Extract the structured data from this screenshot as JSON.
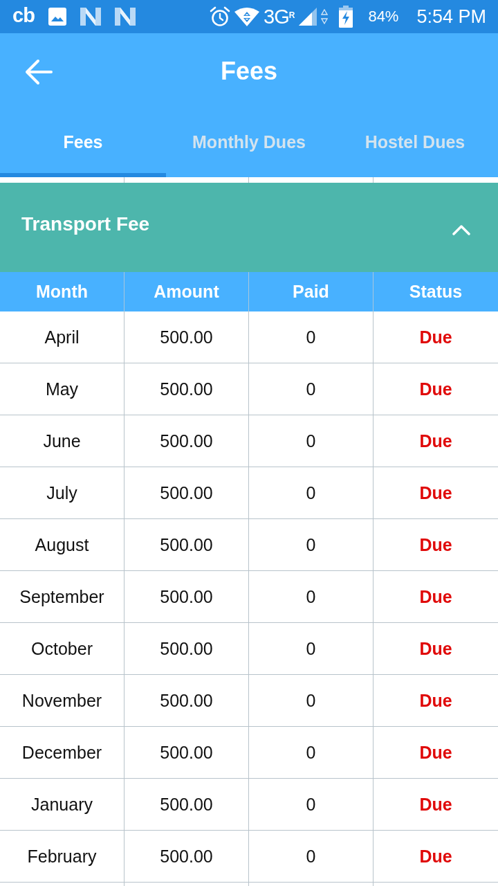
{
  "status_bar": {
    "app_badge": "cb",
    "network_type": "3G",
    "roaming": "R",
    "battery": "84%",
    "time": "5:54 PM"
  },
  "app_bar": {
    "title": "Fees"
  },
  "tabs": [
    {
      "label": "Fees",
      "selected": true
    },
    {
      "label": "Monthly Dues",
      "selected": false
    },
    {
      "label": "Hostel Dues",
      "selected": false
    }
  ],
  "section": {
    "title": "Transport Fee",
    "expanded": true
  },
  "table": {
    "columns": [
      "Month",
      "Amount",
      "Paid",
      "Status"
    ],
    "rows": [
      {
        "month": "April",
        "amount": "500.00",
        "paid": "0",
        "status": "Due",
        "kind": "due"
      },
      {
        "month": "May",
        "amount": "500.00",
        "paid": "0",
        "status": "Due",
        "kind": "due"
      },
      {
        "month": "June",
        "amount": "500.00",
        "paid": "0",
        "status": "Due",
        "kind": "due"
      },
      {
        "month": "July",
        "amount": "500.00",
        "paid": "0",
        "status": "Due",
        "kind": "due"
      },
      {
        "month": "August",
        "amount": "500.00",
        "paid": "0",
        "status": "Due",
        "kind": "due"
      },
      {
        "month": "September",
        "amount": "500.00",
        "paid": "0",
        "status": "Due",
        "kind": "due"
      },
      {
        "month": "October",
        "amount": "500.00",
        "paid": "0",
        "status": "Due",
        "kind": "due"
      },
      {
        "month": "November",
        "amount": "500.00",
        "paid": "0",
        "status": "Due",
        "kind": "due"
      },
      {
        "month": "December",
        "amount": "500.00",
        "paid": "0",
        "status": "Due",
        "kind": "due"
      },
      {
        "month": "January",
        "amount": "500.00",
        "paid": "0",
        "status": "Due",
        "kind": "due"
      },
      {
        "month": "February",
        "amount": "500.00",
        "paid": "0",
        "status": "Due",
        "kind": "due"
      }
    ]
  }
}
